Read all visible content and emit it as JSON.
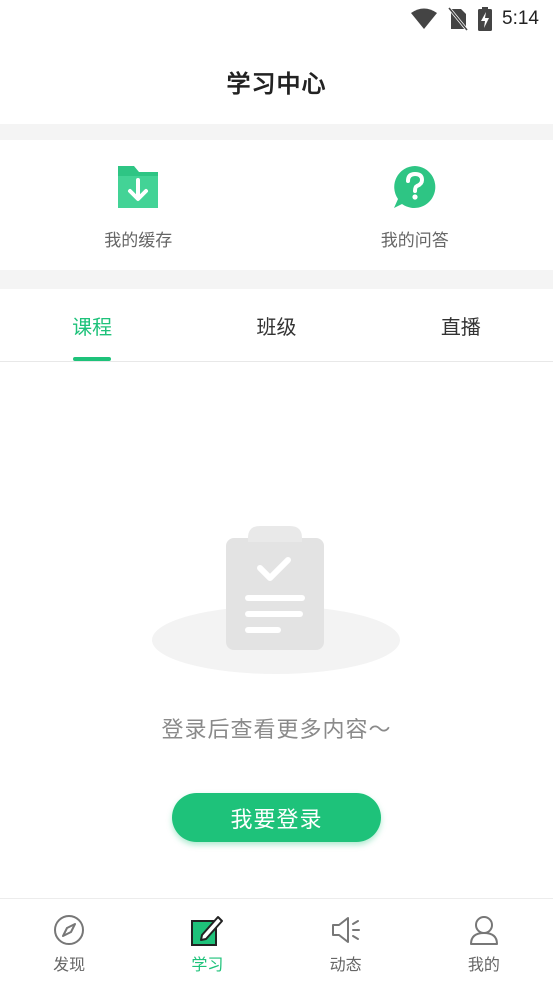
{
  "status_bar": {
    "time": "5:14"
  },
  "header": {
    "title": "学习中心"
  },
  "shortcuts": [
    {
      "label": "我的缓存",
      "icon": "download-folder-icon"
    },
    {
      "label": "我的问答",
      "icon": "question-bubble-icon"
    }
  ],
  "tabs": [
    {
      "label": "课程",
      "active": true
    },
    {
      "label": "班级",
      "active": false
    },
    {
      "label": "直播",
      "active": false
    }
  ],
  "empty_state": {
    "message": "登录后查看更多内容～",
    "button_label": "我要登录",
    "icon": "clipboard-check-icon"
  },
  "bottom_nav": [
    {
      "label": "发现",
      "icon": "compass-icon",
      "active": false
    },
    {
      "label": "学习",
      "icon": "study-pen-icon",
      "active": true
    },
    {
      "label": "动态",
      "icon": "speaker-icon",
      "active": false
    },
    {
      "label": "我的",
      "icon": "user-icon",
      "active": false
    }
  ],
  "colors": {
    "accent": "#1ec27a",
    "separator": "#f4f4f4",
    "inactive_text": "#666666"
  }
}
